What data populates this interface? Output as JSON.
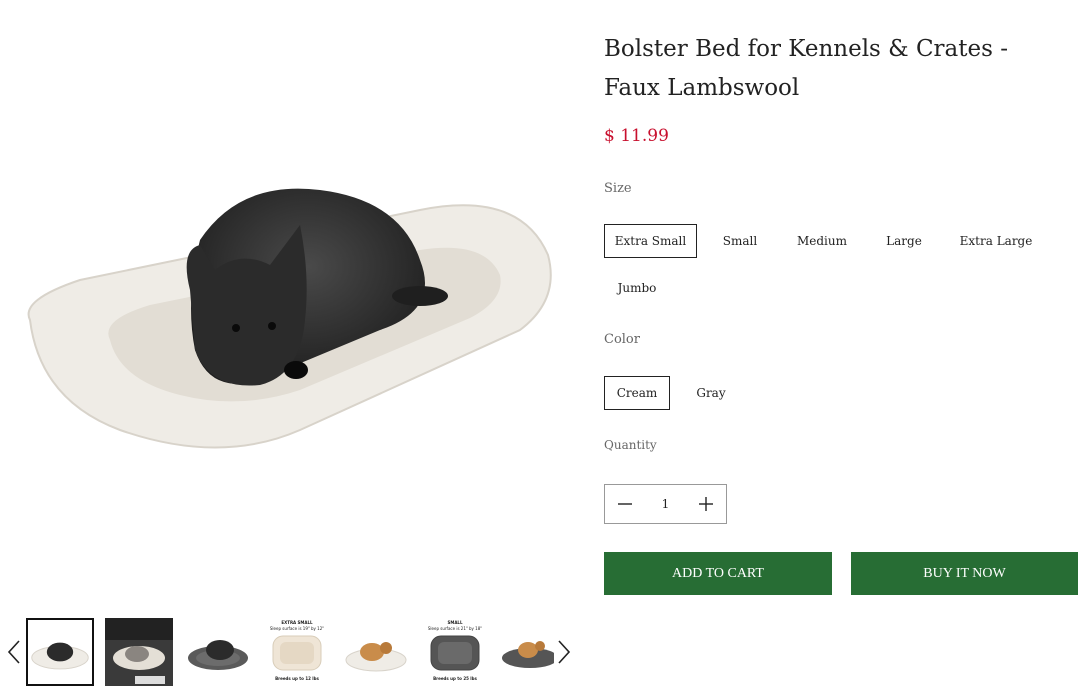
{
  "product": {
    "title": "Bolster Bed for Kennels & Crates - Faux Lambswool",
    "price": "$ 11.99",
    "price_color": "#c8102e"
  },
  "size": {
    "label": "Size",
    "options": [
      "Extra Small",
      "Small",
      "Medium",
      "Large",
      "Extra Large",
      "Jumbo"
    ],
    "selected": "Extra Small"
  },
  "color": {
    "label": "Color",
    "options": [
      "Cream",
      "Gray"
    ],
    "selected": "Cream"
  },
  "quantity": {
    "label": "Quantity",
    "value": "1"
  },
  "buttons": {
    "add_to_cart": "ADD TO CART",
    "buy_now": "BUY IT NOW",
    "button_color": "#276d34"
  },
  "gallery": {
    "thumbnails": [
      {
        "icon": "dog-on-cream-bed-image",
        "active": true
      },
      {
        "icon": "bed-in-car-image",
        "active": false
      },
      {
        "icon": "dog-on-gray-bed-image",
        "active": false
      },
      {
        "icon": "extra-small-dimensions-image",
        "title": "EXTRA SMALL",
        "sub": "Sleep surface is 19\" by 12\"",
        "footer": "Breeds up to 12 lbs",
        "active": false
      },
      {
        "icon": "small-dog-cream-bed-image",
        "active": false
      },
      {
        "icon": "small-dimensions-image",
        "title": "SMALL",
        "sub": "Sleep surface is 21\" by 18\"",
        "footer": "Breeds up to 25 lbs",
        "active": false
      },
      {
        "icon": "small-dog-gray-bed-image",
        "active": false
      }
    ]
  }
}
